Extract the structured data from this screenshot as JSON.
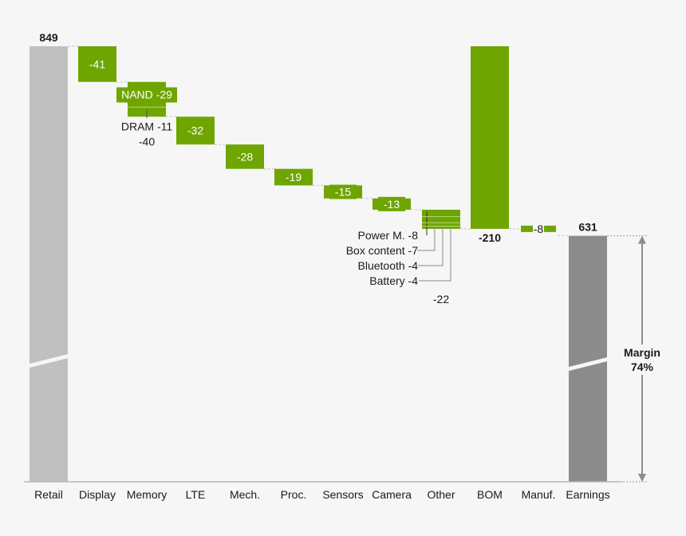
{
  "chart_data": {
    "type": "waterfall",
    "title": "",
    "xlabel": "",
    "ylabel": "",
    "axis_break": true,
    "grid": false,
    "legend": "none",
    "colors": {
      "start_total": "#c0c0c0",
      "end_total": "#8c8c8c",
      "decrease": "#6ea500",
      "subsegment_line": "#b8d87a",
      "connector": "#c8c8c8",
      "text_dark": "#1a1a1a",
      "text_light": "#ffffff",
      "background": "#f6f6f6"
    },
    "categories": [
      "Retail",
      "Display",
      "Memory",
      "LTE",
      "Mech.",
      "Proc.",
      "Sensors",
      "Camera",
      "Other",
      "BOM",
      "Manuf.",
      "Earnings"
    ],
    "bars": [
      {
        "category": "Retail",
        "kind": "total",
        "value": 849,
        "label": "849"
      },
      {
        "category": "Display",
        "kind": "delta",
        "value": -41,
        "label": "-41"
      },
      {
        "category": "Memory",
        "kind": "delta",
        "value": -40,
        "label": "-40",
        "segments": [
          {
            "name": "NAND",
            "value": -29,
            "label": "NAND -29"
          },
          {
            "name": "DRAM",
            "value": -11,
            "label": "DRAM -11"
          }
        ]
      },
      {
        "category": "LTE",
        "kind": "delta",
        "value": -32,
        "label": "-32"
      },
      {
        "category": "Mech.",
        "kind": "delta",
        "value": -28,
        "label": "-28"
      },
      {
        "category": "Proc.",
        "kind": "delta",
        "value": -19,
        "label": "-19"
      },
      {
        "category": "Sensors",
        "kind": "delta",
        "value": -15,
        "label": "-15"
      },
      {
        "category": "Camera",
        "kind": "delta",
        "value": -13,
        "label": "-13"
      },
      {
        "category": "Other",
        "kind": "delta",
        "value": -22,
        "label": "-22",
        "segments": [
          {
            "name": "Power M.",
            "value": -8,
            "label": "Power M. -8"
          },
          {
            "name": "Box content",
            "value": -7,
            "label": "Box content -7"
          },
          {
            "name": "Bluetooth",
            "value": -4,
            "label": "Bluetooth -4"
          },
          {
            "name": "Battery",
            "value": -4,
            "label": "Battery -4"
          }
        ]
      },
      {
        "category": "BOM",
        "kind": "delta_summary",
        "value": -210,
        "label": "-210",
        "note": "Sum of component costs Display..Other, drawn upward from Earnings level"
      },
      {
        "category": "Manuf.",
        "kind": "delta",
        "value": -8,
        "label": "-8"
      },
      {
        "category": "Earnings",
        "kind": "total",
        "value": 631,
        "label": "631"
      }
    ],
    "annotation": {
      "label_line1": "Margin",
      "label_line2": "74%",
      "value_percent": 74,
      "spans": [
        "Earnings top",
        "baseline"
      ]
    }
  }
}
